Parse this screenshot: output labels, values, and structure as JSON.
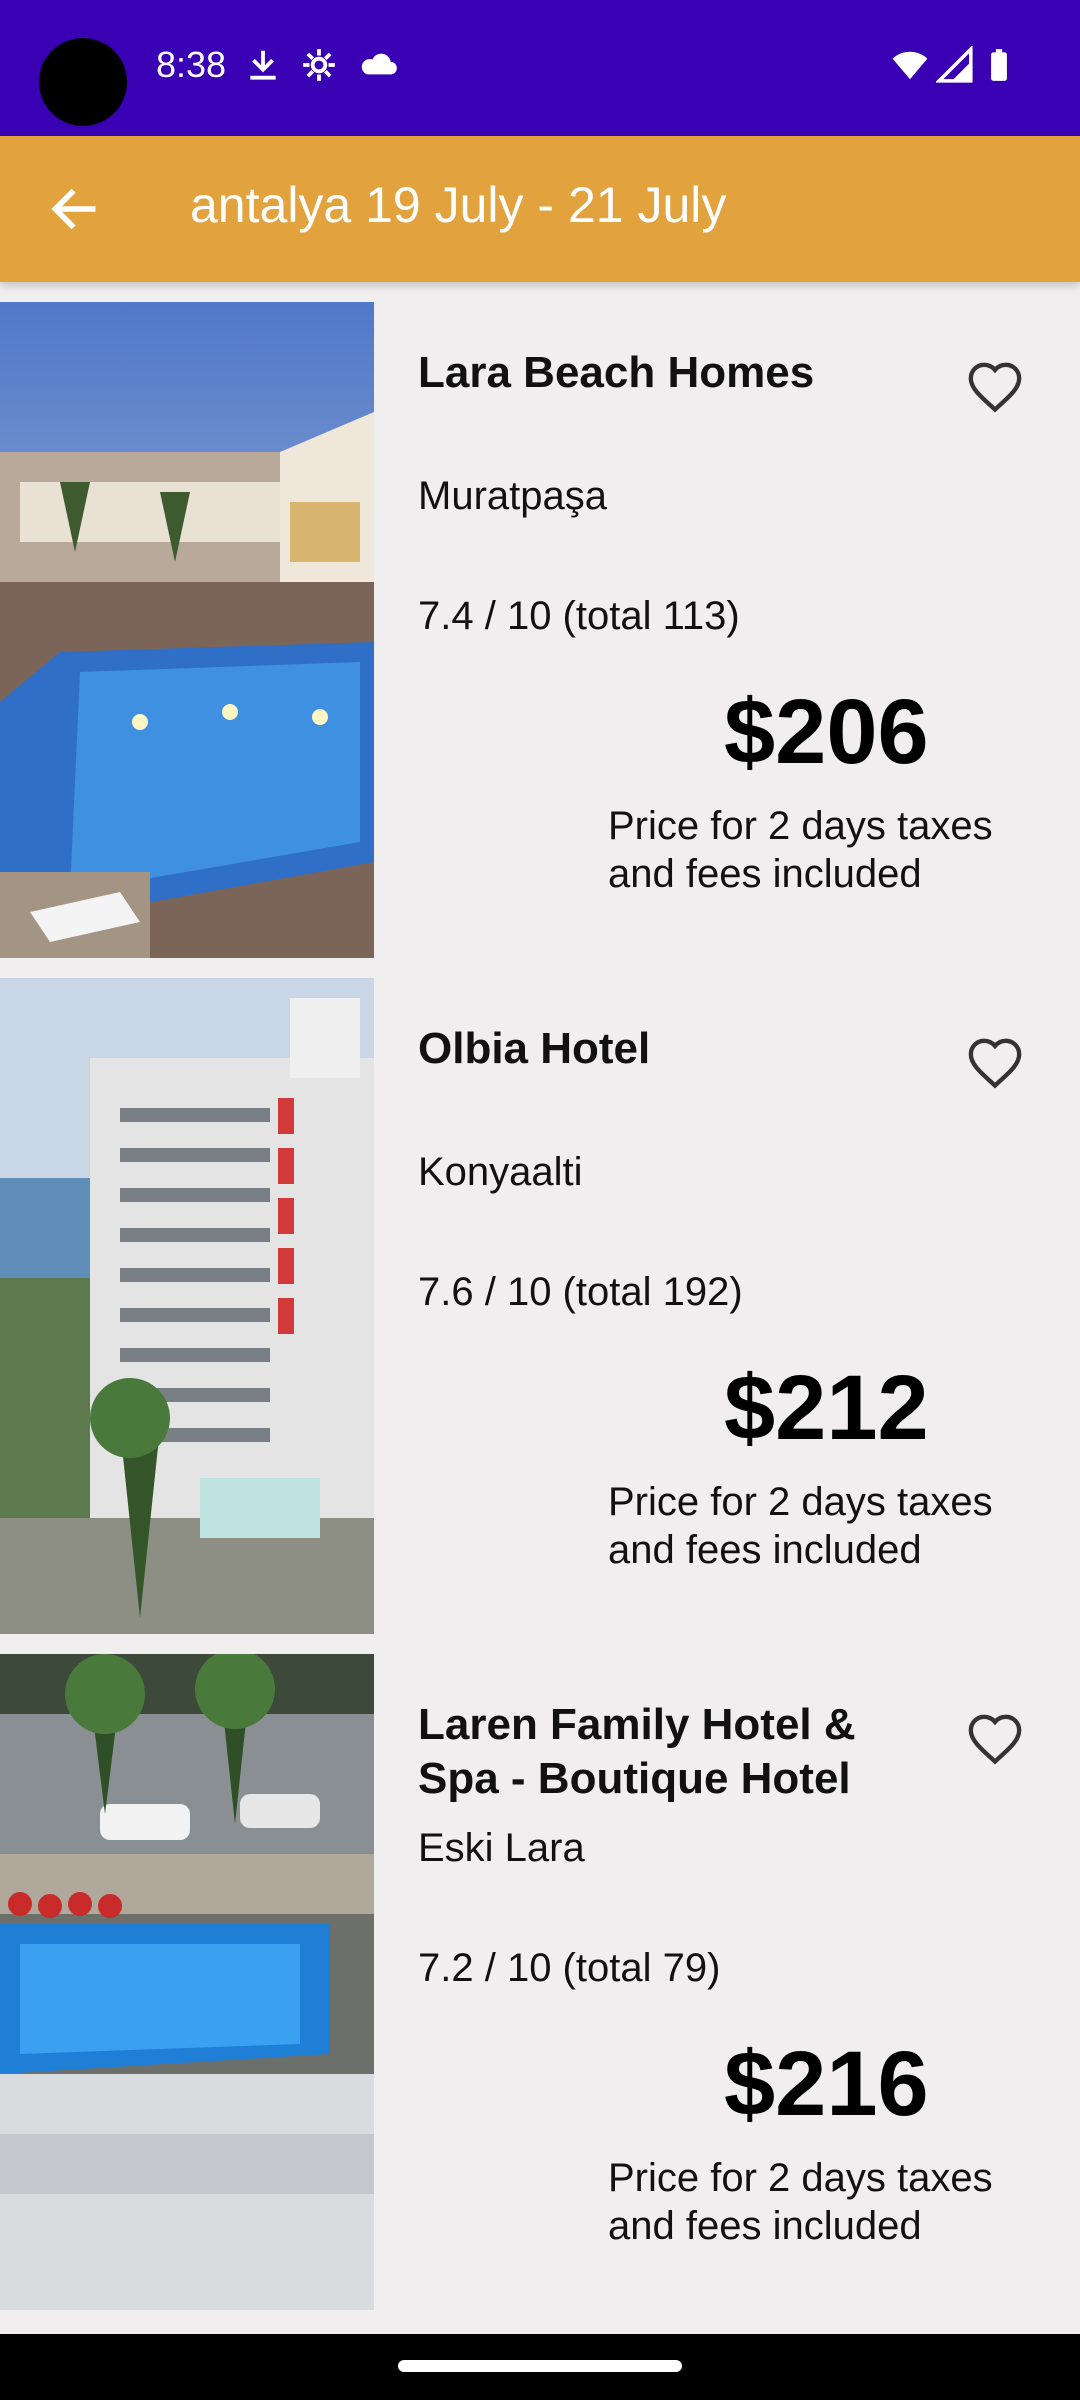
{
  "status_bar": {
    "time": "8:38",
    "icons": [
      "download-icon",
      "settings-icon",
      "cloud-icon",
      "wifi-icon",
      "signal-icon",
      "battery-icon"
    ],
    "background": "#3a00b3"
  },
  "app_bar": {
    "title": "antalya 19 July - 21 July",
    "back_icon": "arrow-left-icon",
    "background": "#e2a33f"
  },
  "hotels": [
    {
      "name": "Lara Beach Homes",
      "district": "Muratpaşa",
      "rating": "7.4 / 10 (total 113)",
      "price": "$206",
      "price_note": "Price for 2 days taxes and fees included",
      "favorite_icon": "heart-outline-icon"
    },
    {
      "name": "Olbia Hotel",
      "district": "Konyaalti",
      "rating": "7.6 / 10 (total 192)",
      "price": "$212",
      "price_note": "Price for 2 days taxes and fees included",
      "favorite_icon": "heart-outline-icon"
    },
    {
      "name": "Laren Family Hotel & Spa -  Boutique Hotel",
      "district": "Eski Lara",
      "rating": "7.2 / 10 (total 79)",
      "price": "$216",
      "price_note": "Price for 2 days taxes and fees included",
      "favorite_icon": "heart-outline-icon"
    }
  ]
}
